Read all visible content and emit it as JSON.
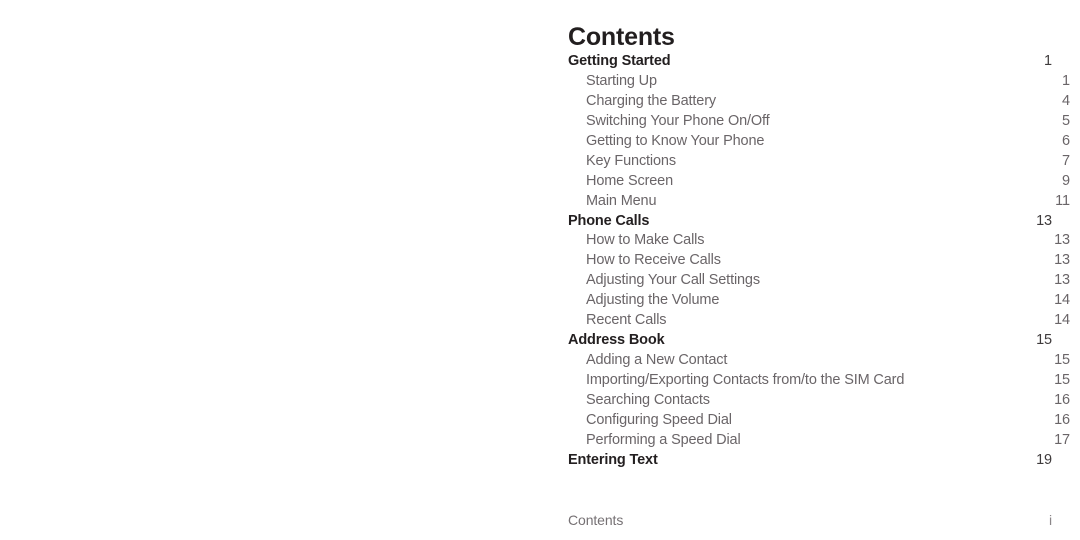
{
  "document": {
    "title": "Contents"
  },
  "toc": {
    "heading": "Contents",
    "entries": [
      {
        "label": "Getting Started",
        "page": "1",
        "level": 1,
        "gap": false
      },
      {
        "label": "Starting Up",
        "page": "1",
        "level": 2,
        "gap": false
      },
      {
        "label": "Charging the Battery",
        "page": "4",
        "level": 2,
        "gap": true
      },
      {
        "label": "Switching Your Phone On/Off",
        "page": "5",
        "level": 2,
        "gap": false
      },
      {
        "label": "Getting to Know Your Phone",
        "page": "6",
        "level": 2,
        "gap": true
      },
      {
        "label": "Key Functions",
        "page": "7",
        "level": 2,
        "gap": true
      },
      {
        "label": "Home Screen",
        "page": "9",
        "level": 2,
        "gap": false
      },
      {
        "label": "Main Menu",
        "page": "11",
        "level": 2,
        "gap": true
      },
      {
        "label": "Phone Calls",
        "page": "13",
        "level": 1,
        "gap": false
      },
      {
        "label": "How to Make Calls",
        "page": "13",
        "level": 2,
        "gap": false
      },
      {
        "label": "How to Receive Calls",
        "page": "13",
        "level": 2,
        "gap": false
      },
      {
        "label": "Adjusting Your Call Settings",
        "page": "13",
        "level": 2,
        "gap": true
      },
      {
        "label": "Adjusting the Volume",
        "page": "14",
        "level": 2,
        "gap": false
      },
      {
        "label": "Recent Calls",
        "page": "14",
        "level": 2,
        "gap": false
      },
      {
        "label": "Address Book",
        "page": "15",
        "level": 1,
        "gap": false
      },
      {
        "label": "Adding a New Contact",
        "page": "15",
        "level": 2,
        "gap": true
      },
      {
        "label": "Importing/Exporting Contacts from/to the SIM Card",
        "page": "15",
        "level": 2,
        "gap": false
      },
      {
        "label": "Searching Contacts",
        "page": "16",
        "level": 2,
        "gap": true
      },
      {
        "label": "Configuring Speed Dial",
        "page": "16",
        "level": 2,
        "gap": false
      },
      {
        "label": "Performing a Speed Dial",
        "page": "17",
        "level": 2,
        "gap": false
      },
      {
        "label": "Entering Text",
        "page": "19",
        "level": 1,
        "gap": true
      }
    ]
  },
  "footer": {
    "label": "Contents",
    "page_number": "i"
  },
  "colors": {
    "heading": "#221e1f",
    "level1_text": "#231f20",
    "level2_text": "#6a6568",
    "leader_dots": "#9b9699",
    "footer_text": "#767174",
    "background": "#ffffff"
  }
}
